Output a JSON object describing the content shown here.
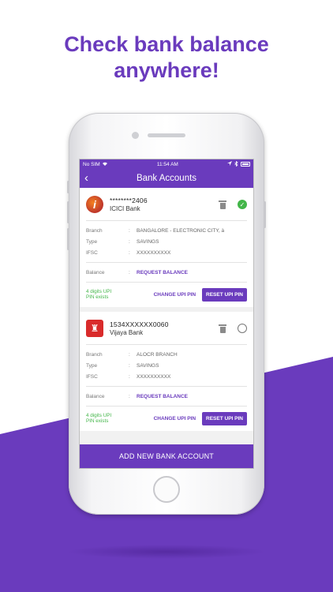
{
  "headline": {
    "line1": "Check bank balance",
    "line2": "anywhere!"
  },
  "status_bar": {
    "carrier": "No SIM",
    "time": "11:54 AM"
  },
  "nav": {
    "title": "Bank Accounts",
    "back_glyph": "‹"
  },
  "labels": {
    "branch": "Branch",
    "type": "Type",
    "ifsc": "IFSC",
    "balance": "Balance",
    "colon": ":",
    "request_balance": "REQUEST BALANCE",
    "change_pin": "CHANGE UPI PIN",
    "reset_pin": "RESET UPI PIN",
    "pin_note_1": "4 digits UPI",
    "pin_note_2": "PIN exists"
  },
  "accounts": [
    {
      "account_number": "********2406",
      "bank_name": "ICICI Bank",
      "logo_glyph": "i",
      "branch": "BANGALORE - ELECTRONIC CITY, à",
      "type": "SAVINGS",
      "ifsc": "XXXXXXXXXX",
      "selected": true
    },
    {
      "account_number": "1534XXXXXX0060",
      "bank_name": "Vijaya Bank",
      "logo_glyph": "♜",
      "branch": "ALOCR BRANCH",
      "type": "SAVINGS",
      "ifsc": "XXXXXXXXXX",
      "selected": false
    }
  ],
  "icons": {
    "check": "✓",
    "trash": "trash-icon"
  },
  "footer": {
    "add_button": "ADD NEW BANK ACCOUNT"
  },
  "colors": {
    "brand": "#6a3bbd",
    "success": "#43b649"
  }
}
